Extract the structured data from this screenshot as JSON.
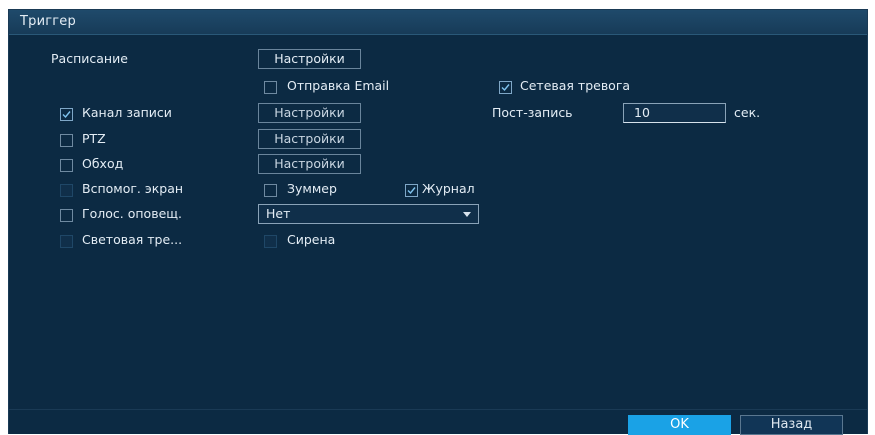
{
  "window": {
    "title": "Триггер"
  },
  "schedule": {
    "label": "Расписание",
    "button": "Настройки"
  },
  "send_email": {
    "label": "Отправка Email",
    "checked": false
  },
  "net_alarm": {
    "label": "Сетевая тревога",
    "checked": true
  },
  "record_channel": {
    "label": "Канал записи",
    "checked": true,
    "button": "Настройки"
  },
  "post_record": {
    "label": "Пост-запись",
    "value": "10",
    "unit": "сек."
  },
  "ptz": {
    "label": "PTZ",
    "checked": false,
    "button": "Настройки"
  },
  "tour": {
    "label": "Обход",
    "checked": false,
    "button": "Настройки"
  },
  "aux_screen": {
    "label": "Вспомог. экран",
    "checked": false
  },
  "buzzer": {
    "label": "Зуммер",
    "checked": false
  },
  "log": {
    "label": "Журнал",
    "checked": true
  },
  "voice_prompt": {
    "label": "Голос. оповещ.",
    "checked": false,
    "select_value": "Нет"
  },
  "light_alarm": {
    "label": "Световая тре...",
    "checked": false
  },
  "siren": {
    "label": "Сирена",
    "checked": false
  },
  "footer": {
    "ok_label": "OK",
    "back_label": "Назад"
  },
  "colors": {
    "background": "#0c2a43",
    "accent": "#1aa2e6",
    "text": "#e4edf5"
  }
}
